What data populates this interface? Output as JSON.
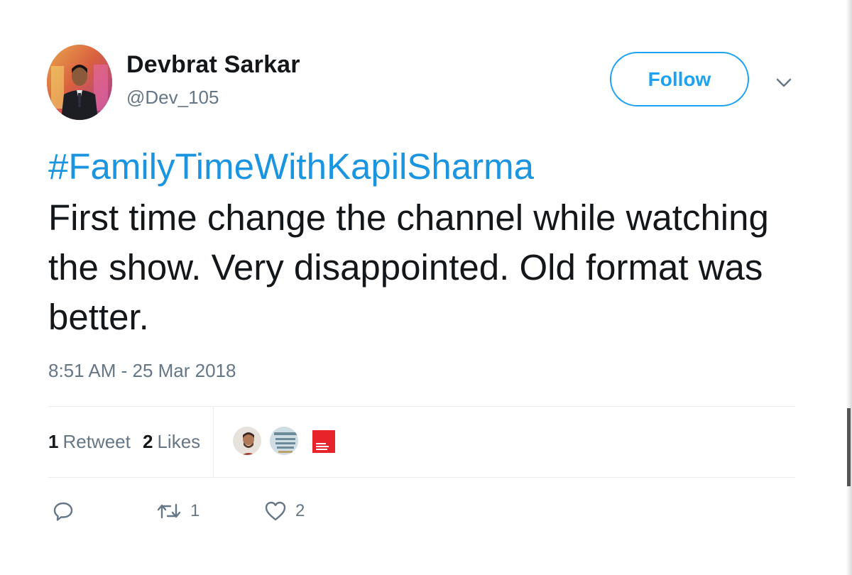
{
  "user": {
    "display_name": "Devbrat Sarkar",
    "screen_name": "@Dev_105",
    "avatar_icon": "profile-photo"
  },
  "header": {
    "follow_label": "Follow",
    "caret_icon": "chevron-down-icon"
  },
  "tweet": {
    "hashtag": "#FamilyTimeWithKapilSharma",
    "text": "First time change the channel while watching the show. Very disappointed. Old format was better.",
    "timestamp": "8:51 AM - 25 Mar 2018"
  },
  "stats": {
    "retweets_count": "1",
    "retweets_label": "Retweet",
    "likes_count": "2",
    "likes_label": "Likes",
    "likers": [
      "liker-avatar-1",
      "liker-avatar-2",
      "liker-avatar-3"
    ]
  },
  "actions": {
    "reply_icon": "reply-icon",
    "retweet_icon": "retweet-icon",
    "retweet_count": "1",
    "like_icon": "heart-icon",
    "like_count": "2"
  },
  "colors": {
    "accent": "#1da1f2",
    "hashtag": "#1b95e0",
    "muted": "#657786",
    "text": "#14171a",
    "divider": "#e6ecf0"
  }
}
